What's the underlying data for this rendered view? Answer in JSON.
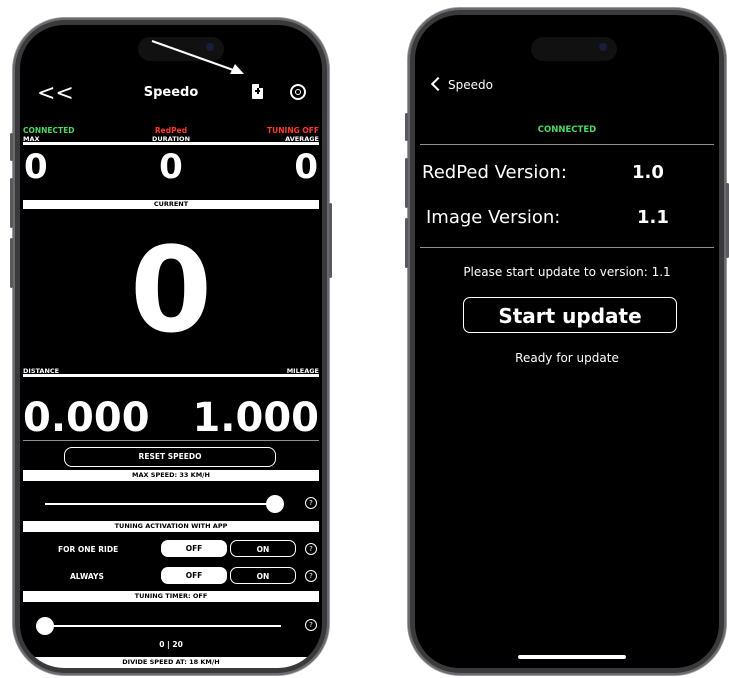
{
  "left": {
    "nav": {
      "back": "<<",
      "title": "Speedo"
    },
    "status": {
      "connected": "CONNECTED",
      "device": "RedPed",
      "tuning": "TUNING OFF"
    },
    "colors": {
      "connected": "#4cd964",
      "red": "#ff3b30"
    },
    "stats_header": {
      "max": "MAX",
      "duration": "DURATION",
      "average": "AVERAGE"
    },
    "stats": {
      "max": "0",
      "duration": "0",
      "average": "0"
    },
    "current_label": "CURRENT",
    "current_value": "0",
    "distance_header": {
      "distance": "DISTANCE",
      "mileage": "MILEAGE"
    },
    "distance": "0.000",
    "mileage": "1.000",
    "reset_button": "RESET SPEEDO",
    "max_speed_label": "MAX SPEED: 33 KM/H",
    "max_speed_slider_fraction": 1.0,
    "help_glyph": "?",
    "tuning_activation_label": "TUNING ACTIVATION WITH APP",
    "rows": [
      {
        "label": "FOR ONE RIDE",
        "off": "OFF",
        "on": "ON"
      },
      {
        "label": "ALWAYS",
        "off": "OFF",
        "on": "ON"
      }
    ],
    "tuning_timer_label": "TUNING TIMER: OFF",
    "tuning_timer_slider_fraction": 0.0,
    "tuning_timer_value": "0 | 20",
    "divide_speed_label": "DIVIDE SPEED AT: 18 KM/H"
  },
  "right": {
    "back_label": "Speedo",
    "connected": "CONNECTED",
    "redped_version_label": "RedPed Version:",
    "redped_version": "1.0",
    "image_version_label": "Image Version:",
    "image_version": "1.1",
    "prompt": "Please start update to version: 1.1",
    "start_button": "Start update",
    "ready": "Ready for update"
  }
}
